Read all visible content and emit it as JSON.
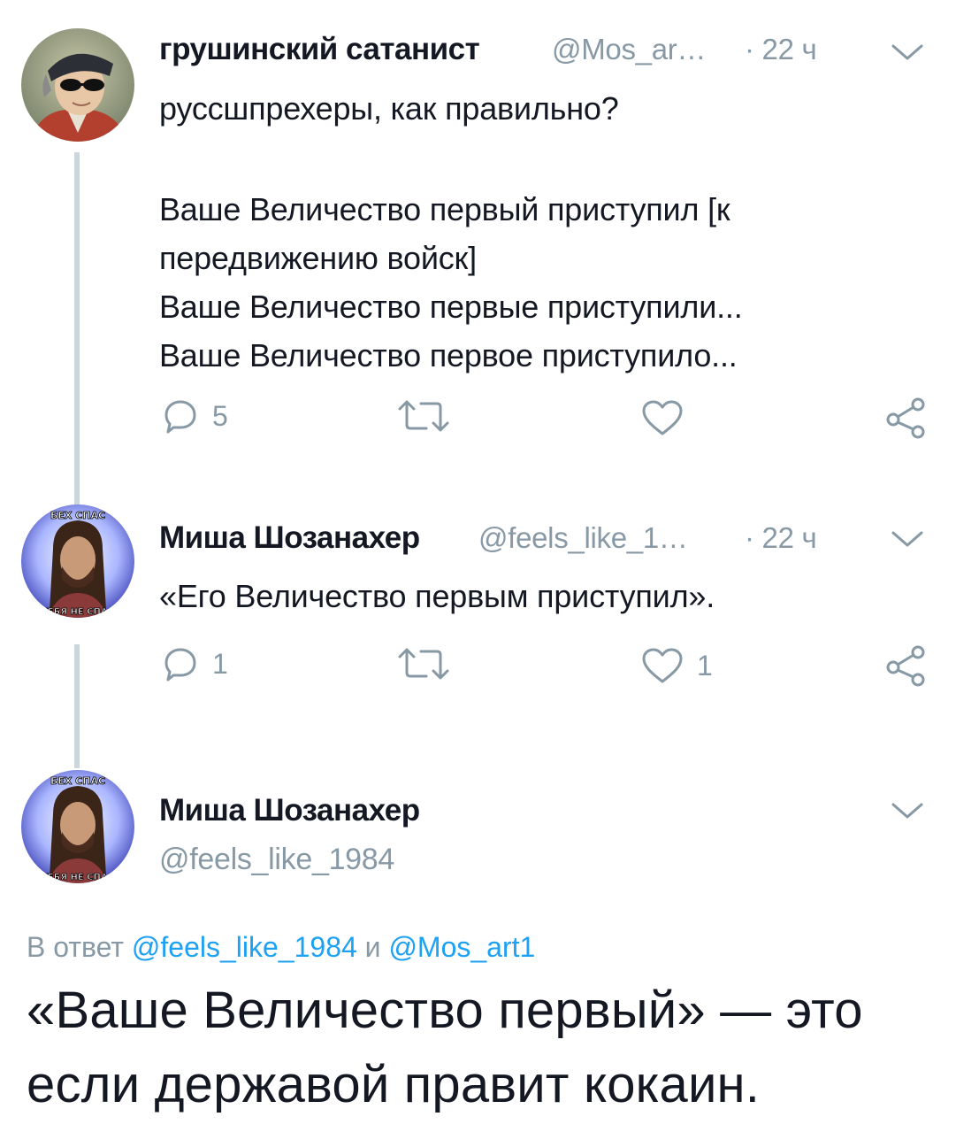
{
  "tweet1": {
    "display_name": "грушинский сатанист",
    "handle": "@Mos_ar…",
    "time": "· 22 ч",
    "lines": [
      "руссшпрехеры, как правильно?",
      "",
      "Ваше Величество первый приступил [к",
      "передвижению войск]",
      "Ваше Величество первые приступили...",
      "Ваше Величество первое приступило..."
    ],
    "reply_count": "5",
    "retweet_count": "",
    "like_count": ""
  },
  "tweet2": {
    "display_name": "Миша Шозанахер",
    "handle": "@feels_like_1…",
    "time": "· 22 ч",
    "text": "«Его Величество первым приступил».",
    "reply_count": "1",
    "retweet_count": "",
    "like_count": "1"
  },
  "tweet3": {
    "display_name": "Миша Шозанахер",
    "handle": "@feels_like_1984",
    "reply_prefix": "В ответ",
    "reply_user1": "@feels_like_1984",
    "reply_and": "и",
    "reply_user2": "@Mos_art1",
    "text_line1": "«Ваше Величество первый» — это",
    "text_line2": "если державой правит кокаин."
  },
  "avatar_labels": {
    "top": "БЕХ СПАС",
    "bottom": "ТЕБЯ НЕ СПАС"
  },
  "colors": {
    "text": "#141823",
    "muted": "#8899a6",
    "link": "#1da1f2",
    "thread_line": "#ccd6dd"
  }
}
